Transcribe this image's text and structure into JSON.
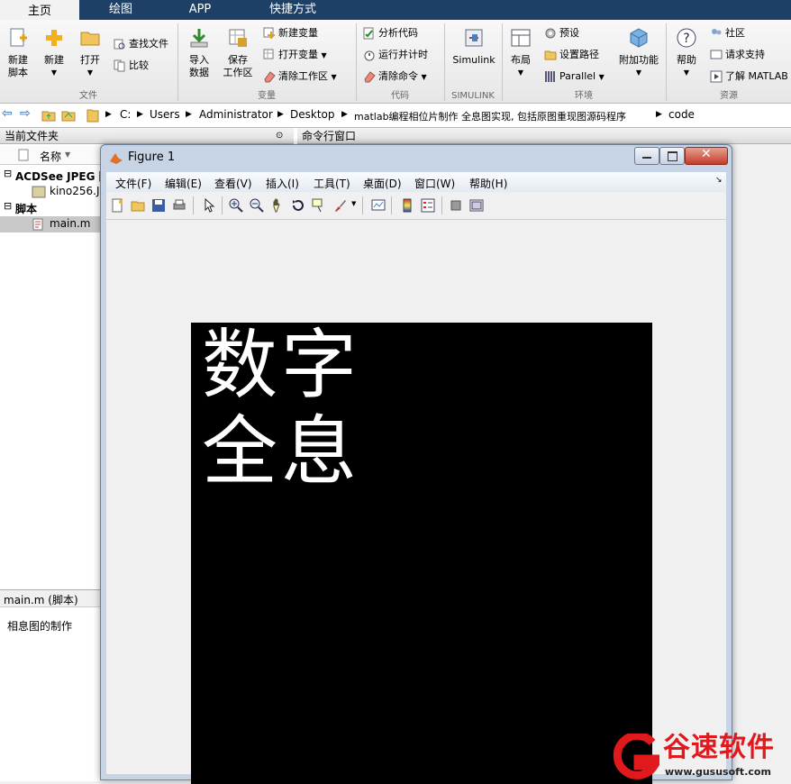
{
  "tabs": [
    {
      "label": "主页",
      "active": true
    },
    {
      "label": "绘图",
      "active": false
    },
    {
      "label": "APP",
      "active": false
    },
    {
      "label": "快捷方式",
      "active": false
    }
  ],
  "ribbon": {
    "new_script": "新建\n脚本",
    "new": "新建",
    "open": "打开",
    "find_files": "查找文件",
    "compare": "比较",
    "import_data": "导入\n数据",
    "save_workspace": "保存\n工作区",
    "new_variable": "新建变量",
    "open_variable": "打开变量",
    "clear_workspace": "清除工作区",
    "analyze_code": "分析代码",
    "run_and_time": "运行并计时",
    "clear_commands": "清除命令",
    "simulink": "Simulink",
    "layout": "布局",
    "preferences": "预设",
    "set_path": "设置路径",
    "parallel": "Parallel",
    "addons": "附加功能",
    "help": "帮助",
    "community": "社区",
    "request_support": "请求支持",
    "learn_matlab": "了解 MATLAB",
    "groups": {
      "file": "文件",
      "variable": "变量",
      "code": "代码",
      "simulink": "SIMULINK",
      "environment": "环境",
      "resources": "资源"
    }
  },
  "address": {
    "parts": [
      "C:",
      "Users",
      "Administrator",
      "Desktop",
      "matlab编程相位片制作 全息图实现, 包括原图重现图源码程序",
      "code"
    ]
  },
  "left": {
    "current_folder_title": "当前文件夹",
    "command_window_title": "命令行窗口",
    "name_col": "名称",
    "group1": "ACDSee JPEG 图",
    "file1": "kino256.JPG",
    "group2": "脚本",
    "file2": "main.m",
    "details_title": "main.m (脚本)",
    "details_text": "相息图的制作"
  },
  "figure": {
    "title": "Figure 1",
    "menu": [
      "文件(F)",
      "编辑(E)",
      "查看(V)",
      "插入(I)",
      "工具(T)",
      "桌面(D)",
      "窗口(W)",
      "帮助(H)"
    ],
    "image_line1": "数字",
    "image_line2": "全息"
  },
  "watermark": {
    "brand": "谷速软件",
    "url": "www.gususoft.com"
  }
}
